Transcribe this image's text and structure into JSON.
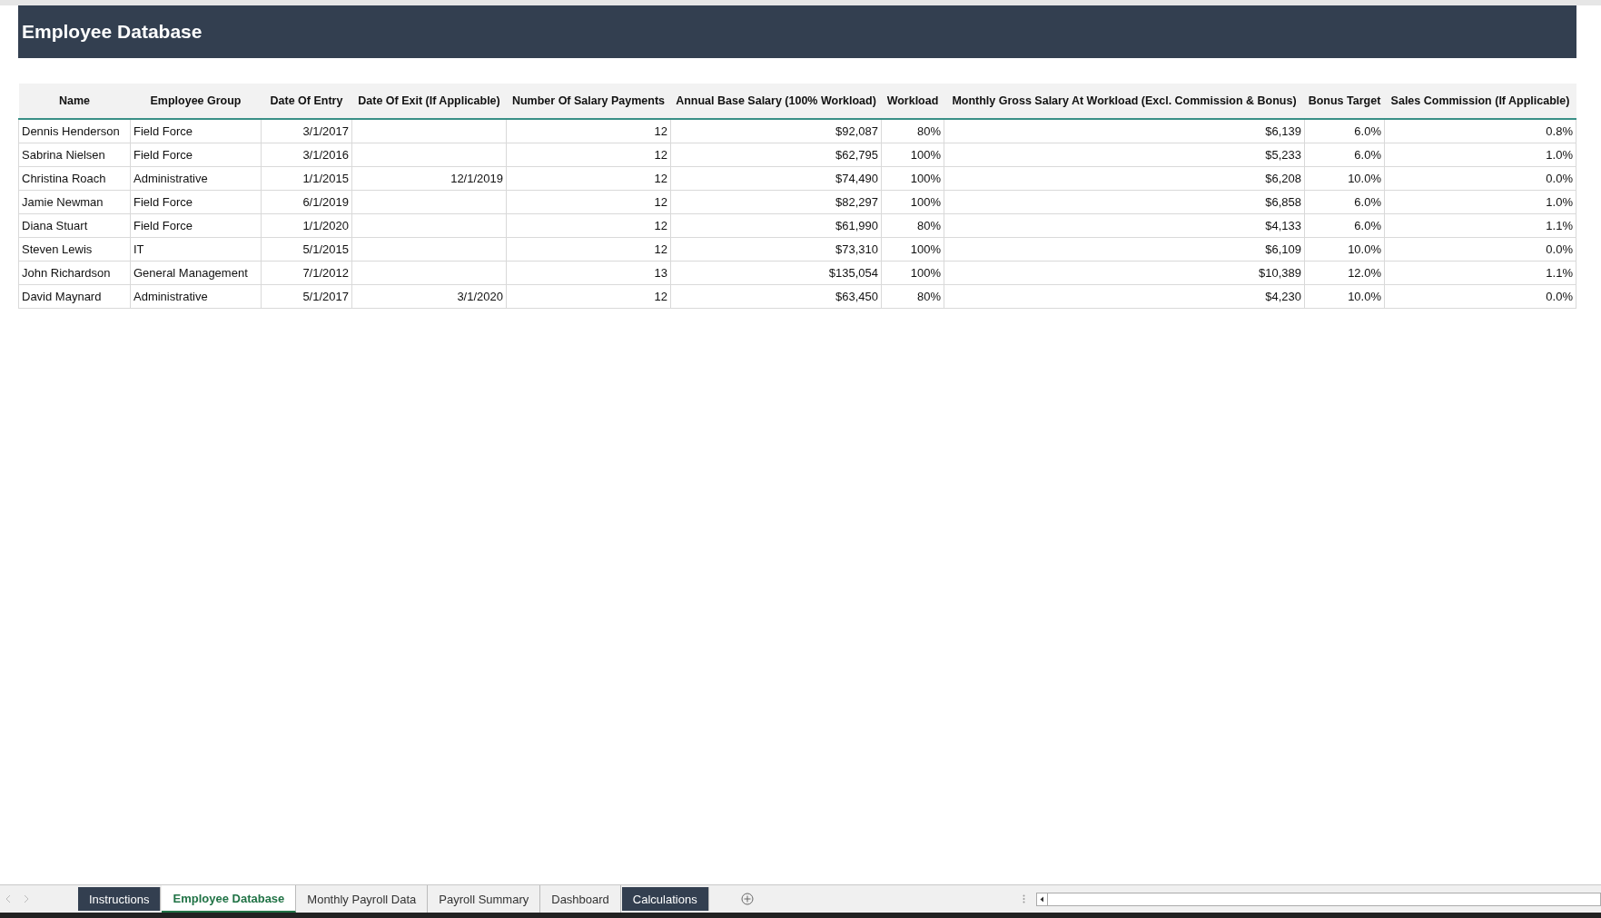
{
  "sheet_title": "Employee Database",
  "table": {
    "columns": [
      {
        "label": "Name",
        "kind": "text"
      },
      {
        "label": "Employee Group",
        "kind": "text"
      },
      {
        "label": "Date Of Entry",
        "kind": "number"
      },
      {
        "label": "Date Of Exit (If Applicable)",
        "kind": "number"
      },
      {
        "label": "Number Of Salary Payments",
        "kind": "number"
      },
      {
        "label": "Annual Base Salary (100% Workload)",
        "kind": "number"
      },
      {
        "label": "Workload",
        "kind": "number"
      },
      {
        "label": "Monthly Gross Salary At Workload (Excl. Commission & Bonus)",
        "kind": "number"
      },
      {
        "label": "Bonus Target",
        "kind": "number"
      },
      {
        "label": "Sales Commission (If Applicable)",
        "kind": "number"
      }
    ],
    "rows": [
      [
        "Dennis Henderson",
        "Field Force",
        "3/1/2017",
        "",
        "12",
        "$92,087",
        "80%",
        "$6,139",
        "6.0%",
        "0.8%"
      ],
      [
        "Sabrina Nielsen",
        "Field Force",
        "3/1/2016",
        "",
        "12",
        "$62,795",
        "100%",
        "$5,233",
        "6.0%",
        "1.0%"
      ],
      [
        "Christina Roach",
        "Administrative",
        "1/1/2015",
        "12/1/2019",
        "12",
        "$74,490",
        "100%",
        "$6,208",
        "10.0%",
        "0.0%"
      ],
      [
        "Jamie Newman",
        "Field Force",
        "6/1/2019",
        "",
        "12",
        "$82,297",
        "100%",
        "$6,858",
        "6.0%",
        "1.0%"
      ],
      [
        "Diana Stuart",
        "Field Force",
        "1/1/2020",
        "",
        "12",
        "$61,990",
        "80%",
        "$4,133",
        "6.0%",
        "1.1%"
      ],
      [
        "Steven Lewis",
        "IT",
        "5/1/2015",
        "",
        "12",
        "$73,310",
        "100%",
        "$6,109",
        "10.0%",
        "0.0%"
      ],
      [
        "John Richardson",
        "General Management",
        "7/1/2012",
        "",
        "13",
        "$135,054",
        "100%",
        "$10,389",
        "12.0%",
        "1.1%"
      ],
      [
        "David Maynard",
        "Administrative",
        "5/1/2017",
        "3/1/2020",
        "12",
        "$63,450",
        "80%",
        "$4,230",
        "10.0%",
        "0.0%"
      ]
    ]
  },
  "sheet_tabs": [
    {
      "label": "Instructions",
      "selected": false,
      "color": "#333f50"
    },
    {
      "label": "Employee Database",
      "selected": true
    },
    {
      "label": "Monthly Payroll Data",
      "selected": false
    },
    {
      "label": "Payroll Summary",
      "selected": false
    },
    {
      "label": "Dashboard",
      "selected": false
    },
    {
      "label": "Calculations",
      "selected": false,
      "color": "#333f50"
    }
  ]
}
